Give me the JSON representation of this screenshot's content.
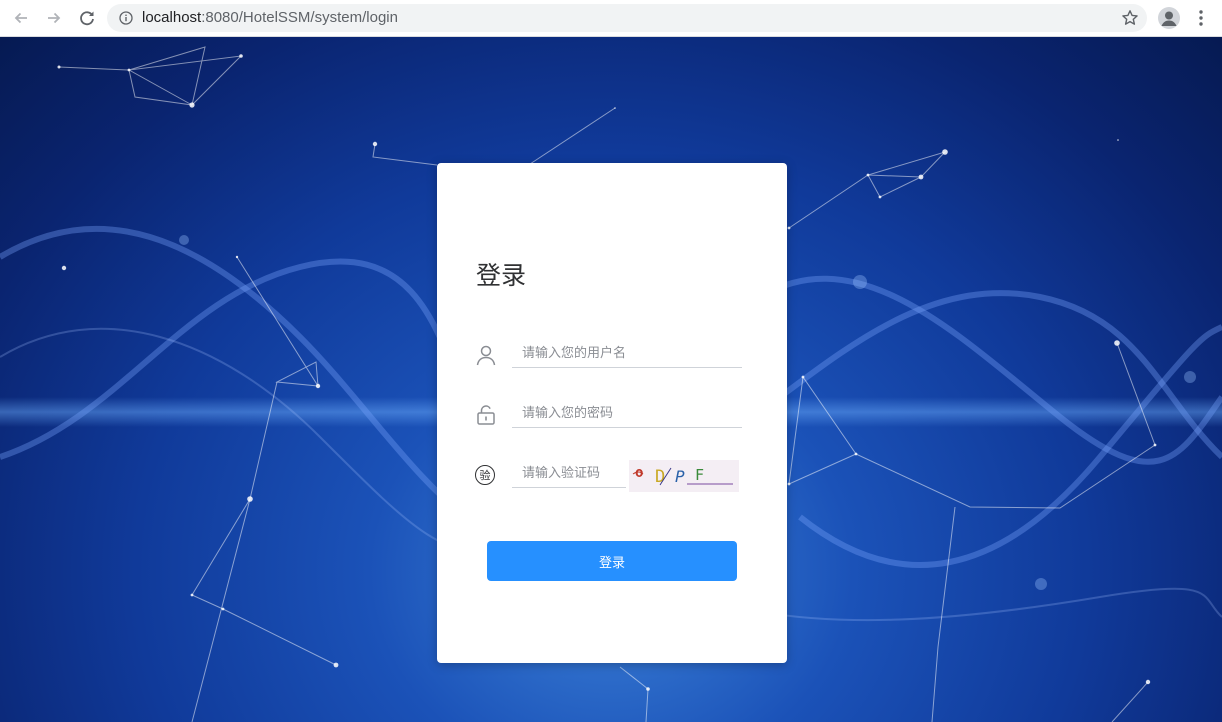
{
  "browser": {
    "url_host": "localhost",
    "url_path": ":8080/HotelSSM/system/login",
    "back_icon": "arrow-left-icon",
    "forward_icon": "arrow-right-icon",
    "reload_icon": "reload-icon",
    "info_icon": "info-icon",
    "star_icon": "star-icon",
    "profile_icon": "avatar-icon",
    "menu_icon": "kebab-menu-icon"
  },
  "login": {
    "title": "登录",
    "username_placeholder": "请输入您的用户名",
    "password_placeholder": "请输入您的密码",
    "captcha_placeholder": "请输入验证码",
    "captcha_icon_text": "验",
    "captcha_chars": [
      "o",
      "D",
      "P",
      "F"
    ],
    "submit_label": "登录"
  },
  "colors": {
    "primary": "#2690ff",
    "card_bg": "#ffffff",
    "title": "#303133",
    "bg_dark": "#061a52",
    "bg_light": "#3d83d9"
  }
}
